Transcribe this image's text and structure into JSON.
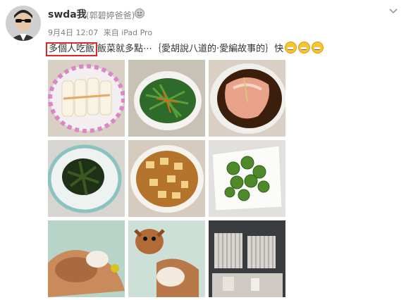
{
  "post": {
    "username": "swda我",
    "remark": "(郭碧婷爸爸)",
    "date": "9月4日 12:07",
    "source": "来自 iPad Pro",
    "text_highlight": "多個人吃飯",
    "text_rest": "飯菜就多點⋯｛愛胡說八道的·愛編故事的｝快",
    "emoji_count": 3
  },
  "icons": {
    "avatar": "user-avatar",
    "badge": "member-badge-icon",
    "menu": "chevron-down-icon",
    "emoji": "grinning-face-icon"
  },
  "photos": [
    {
      "label": "rice rolls on floral plate"
    },
    {
      "label": "stir-fried greens"
    },
    {
      "label": "steamed fish in soy sauce"
    },
    {
      "label": "sweet potato leaves"
    },
    {
      "label": "mapo tofu"
    },
    {
      "label": "brussels sprouts"
    },
    {
      "label": "chihuahua sleeping"
    },
    {
      "label": "chihuahua on bed"
    },
    {
      "label": "bird cages"
    }
  ],
  "colors": {
    "highlight_border": "#e02424",
    "name_text": "#333333",
    "meta_text": "#808080"
  }
}
